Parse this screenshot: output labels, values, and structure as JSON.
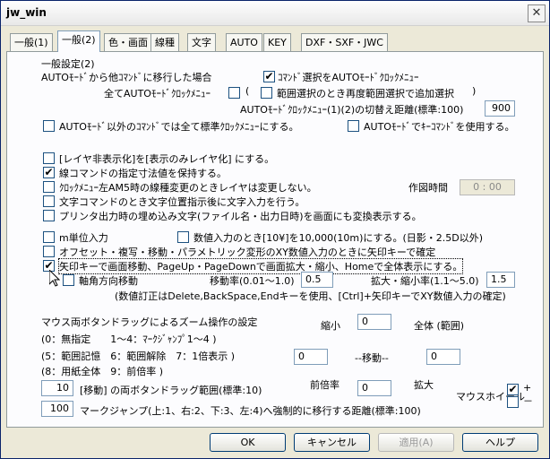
{
  "window": {
    "title": "jw_win",
    "close_icon": "close-icon"
  },
  "tabs": [
    "一般(1)",
    "一般(2)",
    "色・画面",
    "線種",
    "文字",
    "AUTO",
    "KEY",
    "DXF・SXF・JWC"
  ],
  "active_tab": 1,
  "content": {
    "section_title": "一般設定(2)",
    "auto_transition_label": "AUTOﾓｰﾄﾞから他ｺﾏﾝﾄﾞに移行した場合",
    "cmd_select_auto_clock_label": "ｺﾏﾝﾄﾞ選択をAUTOﾓｰﾄﾞｸﾛｯｸﾒﾆｭｰ",
    "cmd_select_auto_clock_checked": true,
    "all_auto_clock_label": "全てAUTOﾓｰﾄﾞｸﾛｯｸﾒﾆｭｰ",
    "all_auto_clock_checked": false,
    "paren_open": "(",
    "range_reselect_label": "範囲選択のとき再度範囲選択で追加選択",
    "range_reselect_checked": false,
    "paren_close": ")",
    "clock_switch_label": "AUTOﾓｰﾄﾞｸﾛｯｸﾒﾆｭｰ(1)(2)の切替え距離(標準:100)",
    "clock_switch_value": "900",
    "non_auto_standard_clock_label": "AUTOﾓｰﾄﾞ以外のｺﾏﾝﾄﾞでは全て標準ｸﾛｯｸﾒﾆｭｰにする。",
    "non_auto_standard_clock_checked": false,
    "auto_key_command_label": "AUTOﾓｰﾄﾞでｷｰｺﾏﾝﾄﾞを使用する。",
    "auto_key_command_checked": false,
    "layer_hide_label": "[レイヤ非表示化]を[表示のみレイヤ化] にする。",
    "layer_hide_checked": false,
    "line_dim_keep_label": "線コマンドの指定寸法値を保持する。",
    "line_dim_keep_checked": true,
    "clock_am5_label": "ｸﾛｯｸﾒﾆｭｰ左AM5時の線種変更のときレイヤは変更しない。",
    "clock_am5_checked": false,
    "drawing_time_label": "作図時間",
    "drawing_time_value": "0 : 00",
    "text_input_after_pos_label": "文字コマンドのとき文字位置指示後に文字入力を行う。",
    "text_input_after_pos_checked": false,
    "printer_embed_label": "プリンタ出力時の埋め込み文字(ファイル名・出力日時)を画面にも変換表示する。",
    "printer_embed_checked": false,
    "m_unit_label": "m単位入力",
    "m_unit_checked": false,
    "numeric_10e4_label": "数値入力のとき[10¥]を10,000(10m)にする。(日影・2.5D以外)",
    "numeric_10e4_checked": false,
    "offset_xy_label": "オフセット・複写・移動・パラメトリック変形のXY数値入力のときに矢印キーで確定",
    "offset_xy_checked": false,
    "arrow_key_move_label": "矢印キーで画面移動、PageUp・PageDownで画面拡大・縮小、Homeで全体表示にする。",
    "arrow_key_move_checked": true,
    "axis_move_label": "軸角方向移動",
    "axis_move_checked": false,
    "move_ratio_label": "移動率(0.01～1.0)",
    "move_ratio_value": "0.5",
    "zoom_ratio_label": "拡大・縮小率(1.1～5.0)",
    "zoom_ratio_value": "1.5",
    "numeric_correction_note": "(数値訂正はDelete,BackSpace,Endキーを使用、[Ctrl]+矢印キーでXY数値入力の確定)",
    "mouse_zoom_title": "マウス両ボタンドラッグによるズーム操作の設定",
    "zoom_opt_line1": "(0：無指定　　1～4：ﾏｰｸｼﾞｬﾝﾌﾟ1～4 )",
    "zoom_opt_line2": "(5：範囲記憶　6：範囲解除　7：1倍表示 )",
    "zoom_opt_line3": "(8：用紙全体　9：前倍率 )",
    "shrink_label": "縮小",
    "shrink_value": "0",
    "whole_label": "全体 (範囲)",
    "left_value": "0",
    "move_label": "--移動--",
    "right_value": "0",
    "prev_zoom_label": "前倍率",
    "bottom_value": "0",
    "enlarge_label": "拡大",
    "drag_range_value": "10",
    "drag_range_label": "[移動] の両ボタンドラッグ範囲(標準:10)",
    "mouse_wheel_label": "マウスホイール",
    "wheel_plus_checked": true,
    "wheel_plus_label": "+",
    "wheel_minus_checked": false,
    "wheel_minus_label": "－",
    "mark_jump_value": "100",
    "mark_jump_label": "マークジャンプ(上:1、右:2、下:3、左:4)へ強制的に移行する距離(標準:100)"
  },
  "buttons": {
    "ok": "OK",
    "cancel": "キャンセル",
    "apply": "適用(A)",
    "help": "ヘルプ"
  }
}
